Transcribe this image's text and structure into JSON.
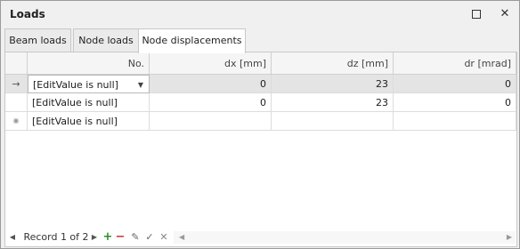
{
  "window": {
    "title": "Loads",
    "maximize_icon": "maximize-icon",
    "close_icon": "close-icon",
    "close_glyph": "✕"
  },
  "tabs": [
    {
      "label": "Beam loads",
      "active": false
    },
    {
      "label": "Node loads",
      "active": false
    },
    {
      "label": "Node displacements",
      "active": true
    }
  ],
  "grid": {
    "columns": [
      "No.",
      "dx [mm]",
      "dz [mm]",
      "dr [mrad]"
    ],
    "rows": [
      {
        "indicator": "→",
        "no": "[EditValue is null]",
        "dx": "0",
        "dz": "23",
        "dr": "0",
        "selected": true
      },
      {
        "indicator": "",
        "no": "[EditValue is null]",
        "dx": "0",
        "dz": "23",
        "dr": "0",
        "selected": false
      }
    ],
    "new_row": {
      "indicator": "✷",
      "no": "[EditValue is null]"
    },
    "dropdown_glyph": "▼"
  },
  "navigator": {
    "first_glyph": "◀",
    "record_text": "Record 1 of 2",
    "next_glyph": "▶",
    "add_glyph": "+",
    "delete_glyph": "−",
    "edit_glyph": "✎",
    "ok_glyph": "✓",
    "cancel_glyph": "✕",
    "scroll_left_glyph": "◀",
    "scroll_right_glyph": "▶"
  },
  "colors": {
    "add": "#2e8b2e",
    "delete": "#c0392b",
    "selected_row": "#e4e4e4"
  }
}
